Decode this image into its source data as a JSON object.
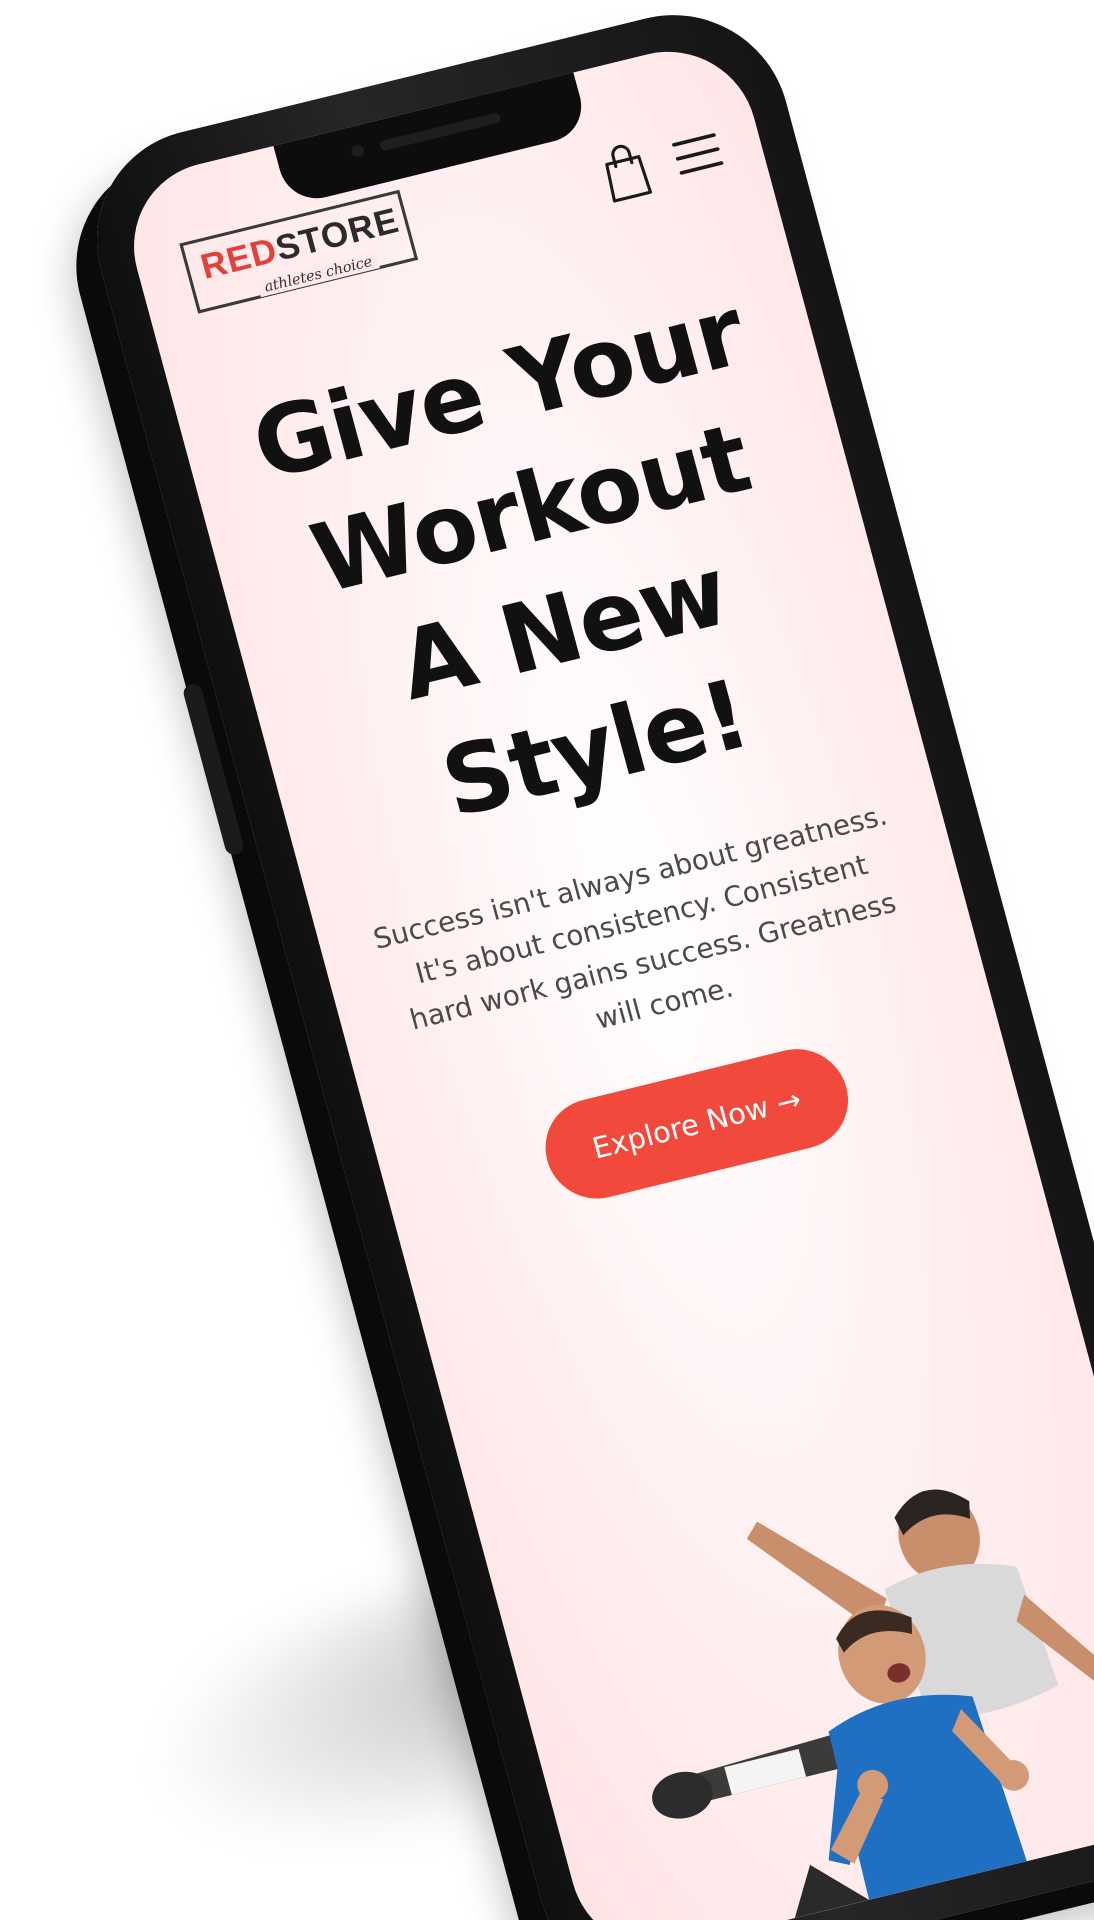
{
  "brand": {
    "logo_red": "RED",
    "logo_dark": "STORE",
    "tagline": "athletes choice"
  },
  "nav": {
    "cart_icon": "shopping-bag-icon",
    "menu_icon": "hamburger-menu-icon"
  },
  "hero": {
    "title_line1": "Give Your",
    "title_line2": "Workout",
    "title_line3": "A New Style!",
    "description": "Success isn't always about greatness. It's about consistency. Consistent hard work gains success. Greatness will come.",
    "cta_label": "Explore Now →"
  },
  "colors": {
    "accent": "#f2493d",
    "screen_bg": "#ffe3e5",
    "phone_frame": "#1a1a1b"
  }
}
